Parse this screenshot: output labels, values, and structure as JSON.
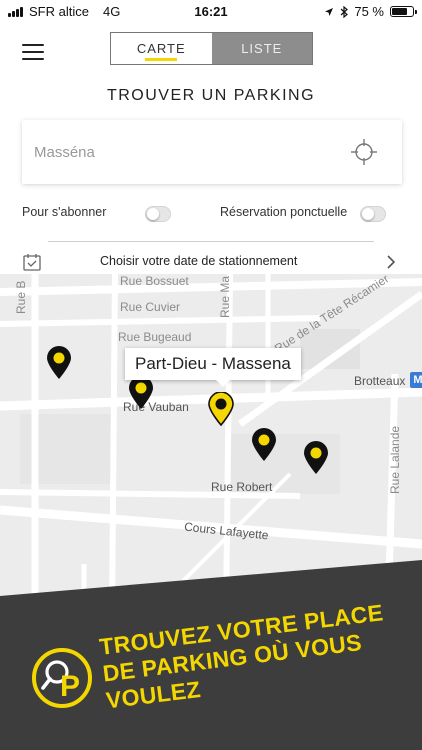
{
  "status_bar": {
    "carrier": "SFR altice",
    "network": "4G",
    "time": "16:21",
    "battery": "75 %",
    "battery_level": 0.75
  },
  "header": {
    "tabs": [
      {
        "label": "CARTE",
        "active": true
      },
      {
        "label": "LISTE",
        "active": false
      }
    ],
    "title": "TROUVER UN PARKING"
  },
  "search": {
    "placeholder": "Masséna",
    "value": ""
  },
  "filters": {
    "subscribe_label": "Pour s'abonner",
    "reservation_label": "Réservation ponctuelle"
  },
  "date_picker": {
    "label": "Choisir votre date de stationnement"
  },
  "map": {
    "streets": {
      "rue_bossuet": "Rue Bossuet",
      "rue_cuvier": "Rue Cuvier",
      "rue_bugeaud": "Rue Bugeaud",
      "rue_vauban": "Rue Vauban",
      "rue_robert": "Rue Robert",
      "cours_lafayette": "Cours Lafayette",
      "rue_recamier": "Rue de la Tête Récamier",
      "rue_lalande": "Rue Lalande",
      "rue_masséna": "Rue Ma",
      "rue_b": "Rue B",
      "brotteaux": "Brotteaux"
    },
    "metro_badge": "M",
    "callout": "Part-Dieu - Massena"
  },
  "banner": {
    "lines": [
      "TROUVEZ VOTRE PLACE",
      "DE PARKING OÙ VOUS",
      "VOULEZ"
    ],
    "logo_letter": "P",
    "colors": {
      "accent": "#f4d600",
      "background": "#3d3d3d"
    }
  }
}
